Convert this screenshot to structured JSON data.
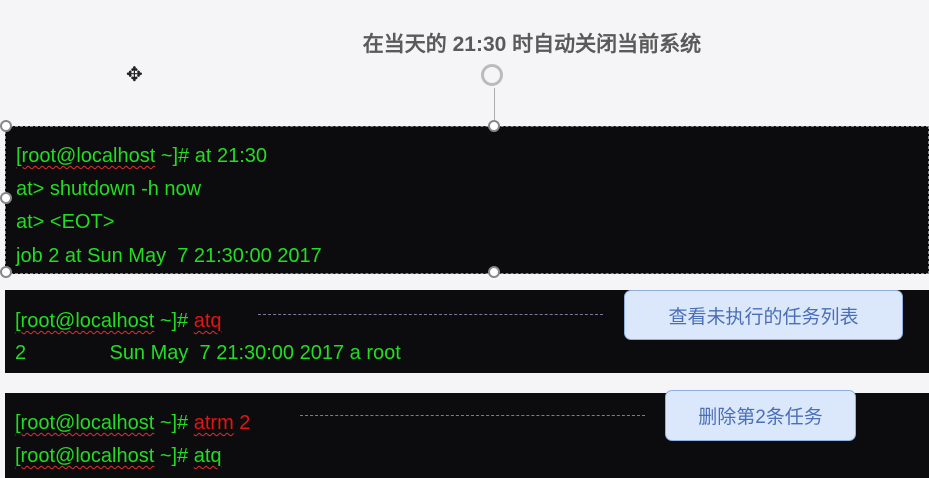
{
  "title": "在当天的 21:30 时自动关闭当前系统",
  "block1": {
    "prompt": "[root@localhost",
    "rest": " ~]# at 21:30",
    "line2": "at> shutdown -h now",
    "line3": "at> <EOT>",
    "line4": "job 2 at Sun May  7 21:30:00 2017"
  },
  "block2": {
    "prompt": "[root@localhost",
    "mid": " ~]# ",
    "cmd": "atq",
    "line2": "2               Sun May  7 21:30:00 2017 a root"
  },
  "block3": {
    "prompt": "[root@localhost",
    "mid": " ~]# ",
    "cmd": "atrm",
    "arg": " 2",
    "prompt2": "[root@localhost",
    "mid2": " ~]# ",
    "cmd2": "atq"
  },
  "callouts": {
    "atq": "查看未执行的任务列表",
    "atrm": "删除第2条任务"
  },
  "colors": {
    "terminal_green": "#22dd22",
    "highlight_red": "#e41414",
    "callout_bg": "#dbe8fb"
  }
}
